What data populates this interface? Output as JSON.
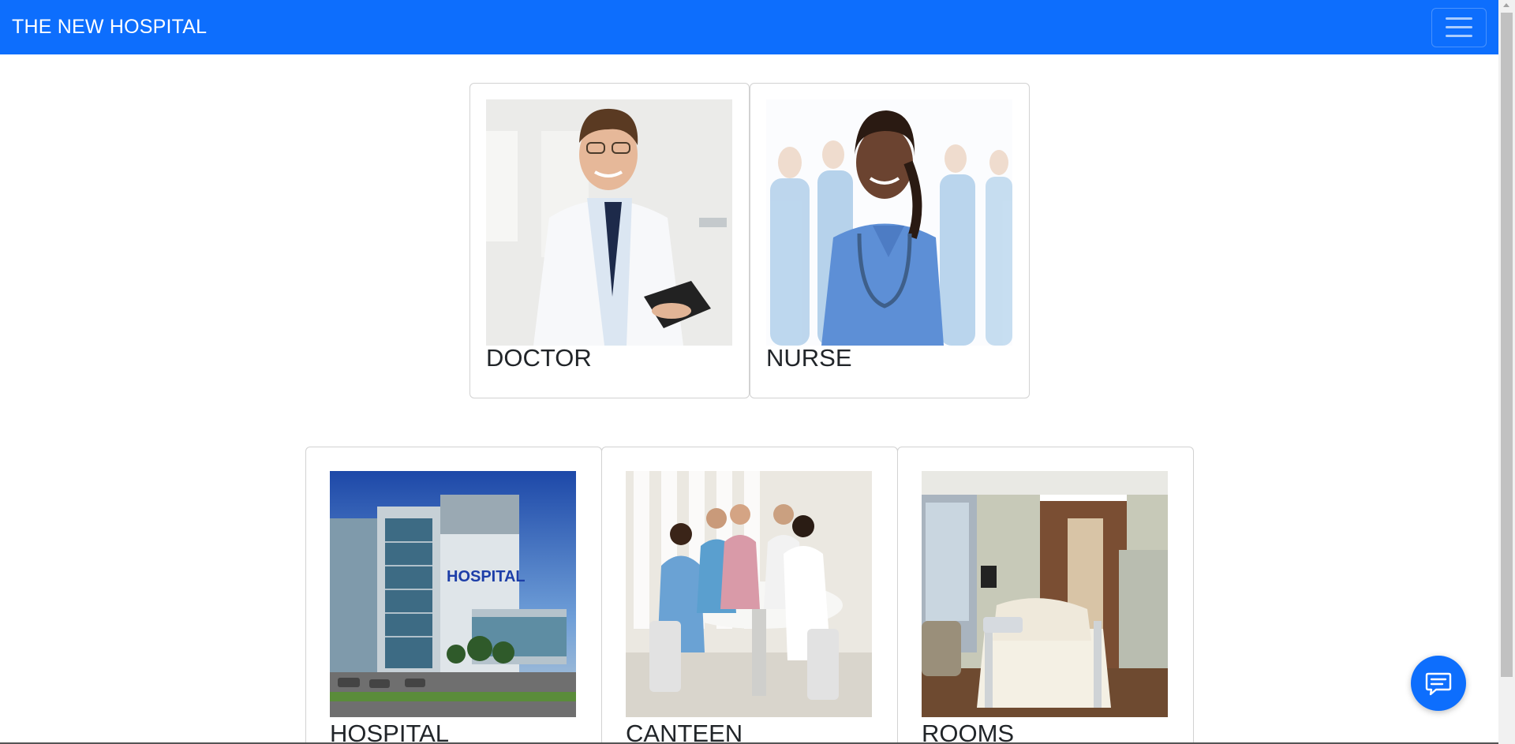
{
  "navbar": {
    "brand": "THE NEW HOSPITAL",
    "toggler_icon": "hamburger-menu-icon",
    "color": "#0d6efd"
  },
  "cards": {
    "doctor": {
      "title": "DOCTOR",
      "image": "doctor-photo"
    },
    "nurse": {
      "title": "NURSE",
      "image": "nurse-photo"
    },
    "hospital": {
      "title": "HOSPITAL",
      "image": "hospital-building-photo"
    },
    "canteen": {
      "title": "CANTEEN",
      "image": "canteen-photo"
    },
    "rooms": {
      "title": "ROOMS",
      "image": "hospital-room-photo"
    }
  },
  "chat_button": {
    "icon": "chat-bubble-icon"
  }
}
